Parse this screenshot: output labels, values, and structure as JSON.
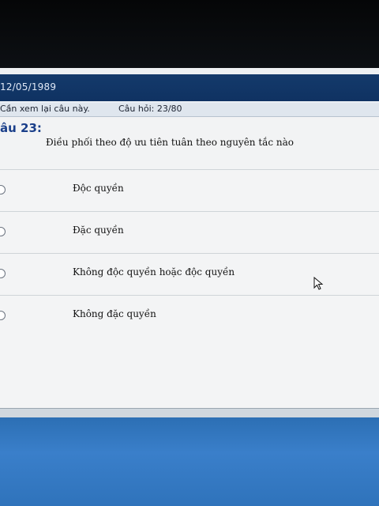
{
  "header": {
    "date": "12/05/1989"
  },
  "info": {
    "review_label": "Cần xem lại câu này.",
    "question_count": "Câu hỏi: 23/80"
  },
  "question": {
    "number": "âu 23:",
    "text": "Điều phối theo độ ưu tiên tuân theo nguyên tắc nào"
  },
  "options": [
    {
      "label": "Độc quyền"
    },
    {
      "label": "Đặc quyền"
    },
    {
      "label": "Không độc quyền hoặc độc quyền"
    },
    {
      "label": "Không đặc quyền"
    }
  ],
  "colors": {
    "header": "#143a6b",
    "question_number": "#1a3f8a",
    "taskbar": "#2f73bb"
  },
  "icons": {
    "cursor": "mouse-pointer-icon",
    "radio": "radio-button-icon"
  }
}
